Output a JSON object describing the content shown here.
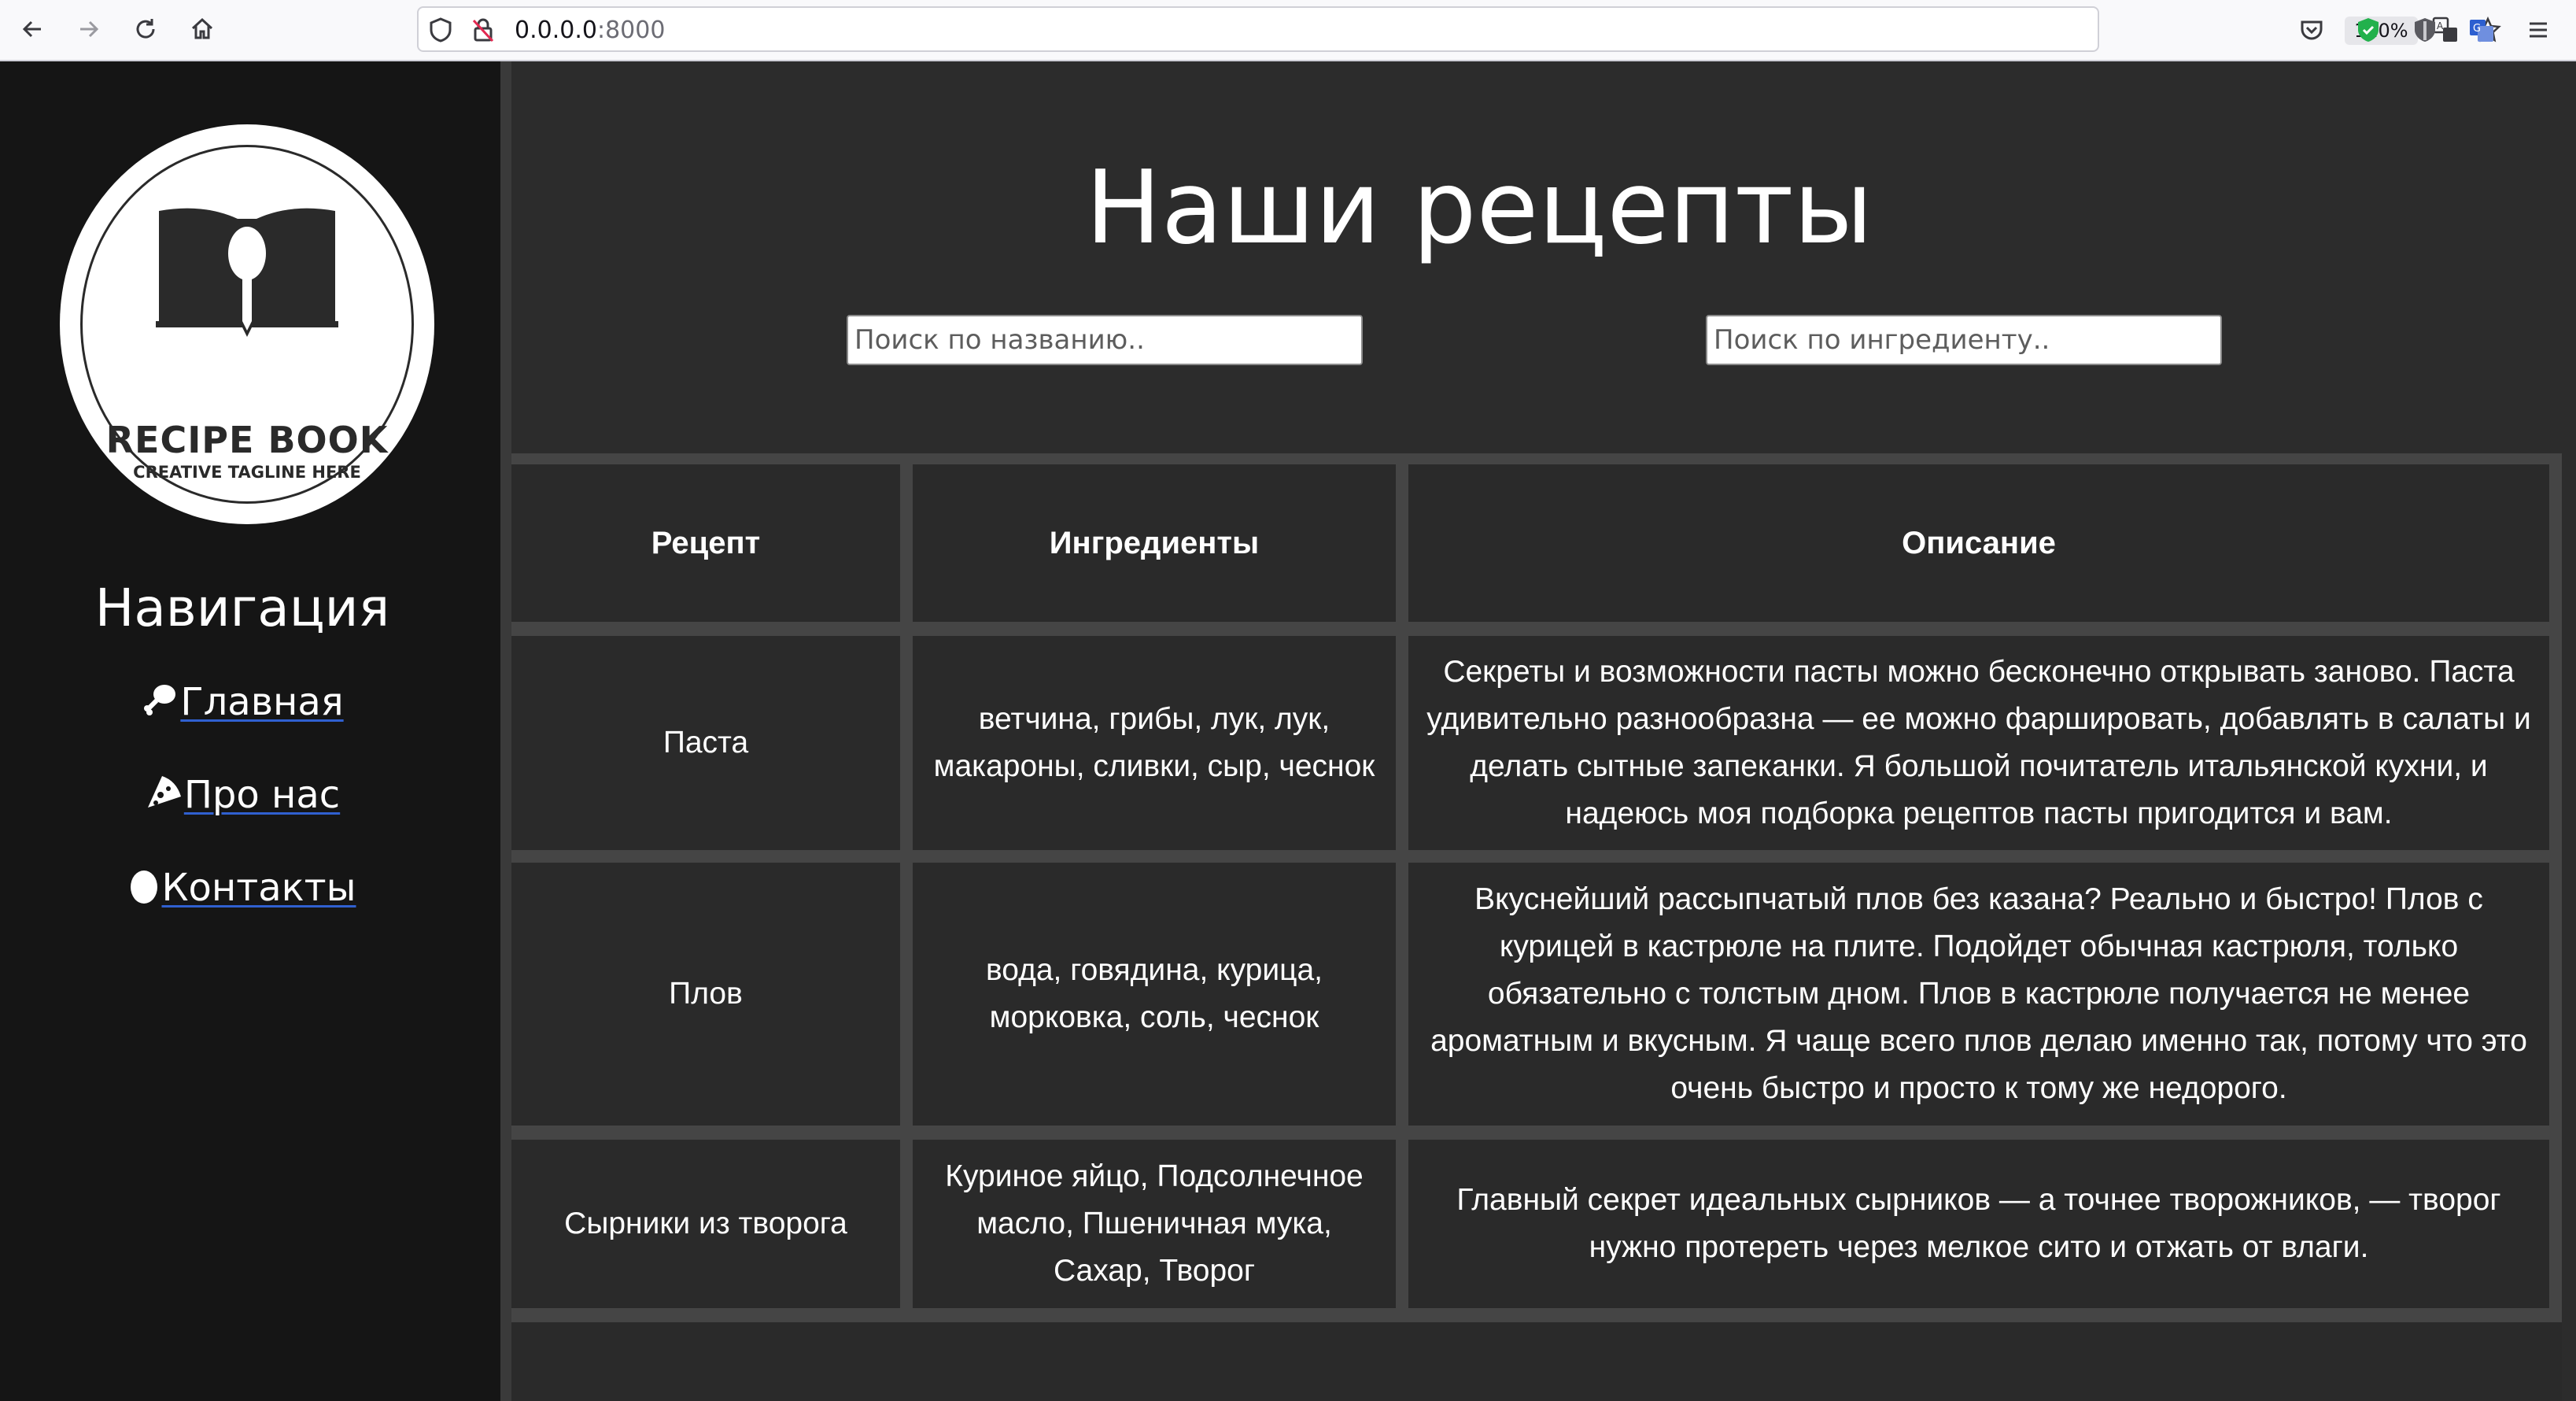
{
  "browser": {
    "url_host": "0.0.0.0",
    "url_port": ":8000",
    "zoom": "110%",
    "icons": [
      "back-icon",
      "forward-icon",
      "reload-icon",
      "home-icon",
      "shield-icon",
      "insecure-lock-icon",
      "translate-icon",
      "bookmark-star-icon",
      "pocket-icon",
      "extension-shield-green-icon",
      "extension-shield-grey-icon",
      "extension-translate-icon",
      "menu-icon"
    ]
  },
  "sidebar": {
    "logo": {
      "title": "RECIPE BOOK",
      "tagline": "CREATIVE TAGLINE HERE"
    },
    "nav_title": "Навигация",
    "links": [
      {
        "label": "Главная",
        "icon": "chicken-leg-icon"
      },
      {
        "label": "Про нас",
        "icon": "pizza-slice-icon"
      },
      {
        "label": "Контакты",
        "icon": "egg-icon"
      }
    ]
  },
  "main": {
    "title": "Наши рецепты",
    "search_name_placeholder": "Поиск по названию..",
    "search_ingredient_placeholder": "Поиск по ингредиенту..",
    "table": {
      "headers": [
        "Рецепт",
        "Ингредиенты",
        "Описание"
      ],
      "rows": [
        {
          "recipe": "Паста",
          "ingredients": "ветчина, грибы, лук, лук, макароны, сливки, сыр, чеснок",
          "description": "Секреты и возможности пасты можно бесконечно открывать заново. Паста удивительно разнообразна — ее можно фаршировать, добавлять в салаты и делать сытные запеканки. Я большой почитатель итальянской кухни, и надеюсь моя подборка рецептов пасты пригодится и вам."
        },
        {
          "recipe": "Плов",
          "ingredients": "вода, говядина, курица, морковка, соль, чеснок",
          "description": "Вкуснейший рассыпчатый плов без казана? Реально и быстро! Плов с курицей в кастрюле на плите. Подойдет обычная кастрюля, только обязательно с толстым дном. Плов в кастрюле получается не менее ароматным и вкусным. Я чаще всего плов делаю именно так, потому что это очень быстро и просто к тому же недорого."
        },
        {
          "recipe": "Сырники из творога",
          "ingredients": "Куриное яйцо, Подсолнечное масло, Пшеничная мука, Сахар, Творог",
          "description": "Главный секрет идеальных сырников — а точнее творожников, — творог нужно протереть через мелкое сито и отжать от влаги."
        }
      ]
    }
  }
}
